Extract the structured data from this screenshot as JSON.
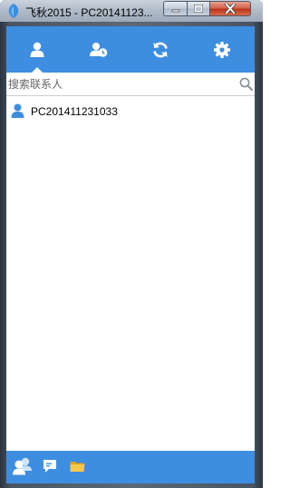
{
  "window": {
    "title": "飞秋2015 - PC20141123...",
    "controls": [
      "minimize",
      "maximize",
      "close"
    ]
  },
  "toolbar": {
    "tabs": [
      {
        "icon": "contacts-icon",
        "active": true
      },
      {
        "icon": "recent-contacts-icon",
        "active": false
      },
      {
        "icon": "refresh-icon",
        "active": false
      },
      {
        "icon": "settings-icon",
        "active": false
      }
    ]
  },
  "search": {
    "placeholder": "搜索联系人",
    "value": ""
  },
  "contacts": [
    {
      "name": "PC201411231033",
      "icon": "user-icon"
    }
  ],
  "bottombar": {
    "buttons": [
      {
        "icon": "group-chat-icon"
      },
      {
        "icon": "message-icon"
      },
      {
        "icon": "folder-icon"
      }
    ]
  },
  "colors": {
    "accent": "#3d8ee0",
    "close_button": "#c8452a"
  }
}
